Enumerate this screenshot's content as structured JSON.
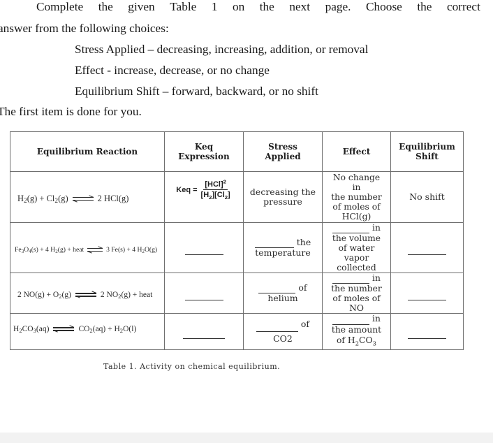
{
  "instructions": {
    "line1_words": [
      "Complete",
      "the",
      "given",
      "Table",
      "1",
      "on",
      "the",
      "next",
      "page.",
      "Choose",
      "the",
      "correct"
    ],
    "line2": "answer from the following choices:",
    "choices": [
      "Stress Applied – decreasing, increasing, addition, or removal",
      "Effect - increase, decrease, or no change",
      "Equilibrium Shift – forward, backward, or no shift"
    ],
    "note": "The first item is done for you."
  },
  "table": {
    "headers": {
      "reaction": "Equilibrium Reaction",
      "keq_line1": "Keq",
      "keq_line2": "Expression",
      "stress_line1": "Stress",
      "stress_line2": "Applied",
      "effect": "Effect",
      "shift_line1": "Equilibrium",
      "shift_line2": "Shift"
    },
    "rows": [
      {
        "reaction": {
          "reactants": [
            "H",
            "2",
            "(g) + Cl",
            "2",
            "(g)"
          ],
          "products": [
            "2 HCl(g)"
          ]
        },
        "keq": {
          "label": "Keq =",
          "numerator": "[HCl]",
          "numerator_power": "2",
          "den_a": "[H",
          "den_a_sub": "2",
          "den_b": "][Cl",
          "den_b_sub": "2",
          "den_c": "]"
        },
        "stress": [
          "decreasing the",
          "pressure"
        ],
        "effect": [
          "No change",
          "in",
          "the number",
          "of moles of",
          "HCl(g)"
        ],
        "shift": "No shift"
      },
      {
        "reaction": {
          "reactants": [
            "Fe",
            "3",
            "O",
            "4",
            "(s) + 4 H",
            "2",
            "(g) + heat"
          ],
          "products": [
            "3 Fe(s) + 4 H",
            "2",
            "O(g)"
          ]
        },
        "stress": [
          "the",
          "temperature"
        ],
        "effect": [
          "in",
          "the volume",
          "of water",
          "vapor",
          "collected"
        ]
      },
      {
        "reaction": {
          "reactants": [
            "2 NO(g) + O",
            "2",
            "(g)"
          ],
          "products": [
            "2 NO",
            "2",
            "(g) + heat"
          ]
        },
        "stress": [
          "of",
          "helium"
        ],
        "effect": [
          "in",
          "the number",
          "of moles of",
          "NO"
        ]
      },
      {
        "reaction": {
          "reactants": [
            "H",
            "2",
            "CO",
            "3",
            "(aq)"
          ],
          "products": [
            "CO",
            "2",
            "(aq)  + H",
            "2",
            "O(l)"
          ]
        },
        "stress": [
          "of",
          "CO2"
        ],
        "effect": [
          "in",
          "the amount",
          "of H",
          "2",
          "CO",
          "3"
        ]
      }
    ]
  },
  "caption": "Table 1. Activity on chemical equilibrium."
}
